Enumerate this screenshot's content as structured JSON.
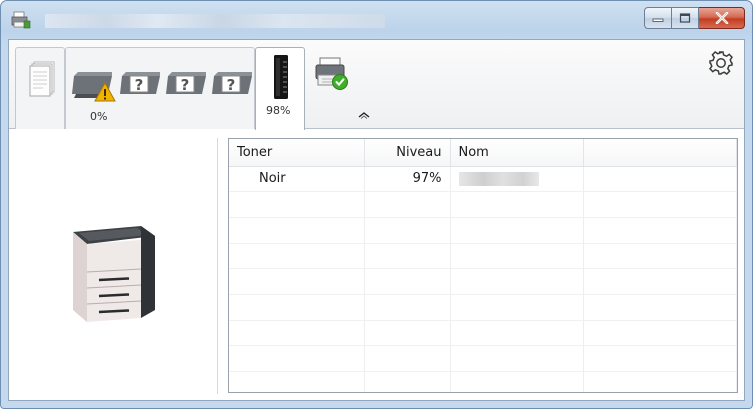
{
  "window": {
    "title": "",
    "controls": {
      "minimize": "minimize",
      "maximize": "maximize",
      "close": "close"
    }
  },
  "tabs": [
    {
      "id": "jobs",
      "icon": "documents-stack-icon",
      "label": ""
    },
    {
      "id": "paper",
      "icon": "paper-trays-icon",
      "label": "0%",
      "status": "warning"
    },
    {
      "id": "toner",
      "icon": "toner-cartridge-icon",
      "label": "98%",
      "active": true
    },
    {
      "id": "device",
      "icon": "printer-ready-icon",
      "label": ""
    }
  ],
  "toner_table": {
    "columns": [
      "Toner",
      "Niveau",
      "Nom",
      ""
    ],
    "rows": [
      {
        "toner": "Noir",
        "niveau": "97%",
        "nom": ""
      }
    ],
    "empty_rows": 8
  },
  "colors": {
    "titlebar": "#bcd3ea",
    "close_button": "#c33d22",
    "warning": "#f0b400",
    "ok_check": "#3fae2a"
  }
}
